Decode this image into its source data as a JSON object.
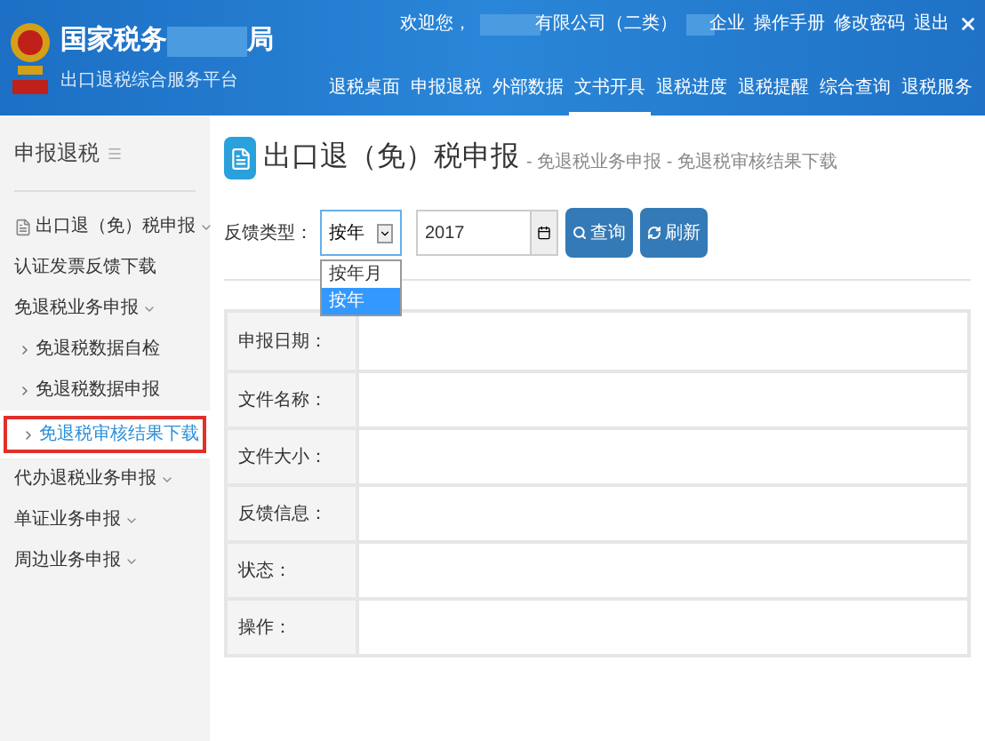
{
  "header": {
    "title": "国家税务",
    "title_suffix": "局",
    "subtitle": "出口退税综合服务平台",
    "greeting": "欢迎您，",
    "company": "有限公司（二类）",
    "user_type": "企业",
    "links": [
      "操作手册",
      "修改密码",
      "退出"
    ],
    "nav": [
      {
        "label": "退税桌面",
        "selected": false
      },
      {
        "label": "申报退税",
        "selected": false
      },
      {
        "label": "外部数据",
        "selected": false
      },
      {
        "label": "文书开具",
        "selected": true
      },
      {
        "label": "退税进度",
        "selected": false
      },
      {
        "label": "退税提醒",
        "selected": false
      },
      {
        "label": "综合查询",
        "selected": false
      },
      {
        "label": "退税服务",
        "selected": false
      }
    ]
  },
  "sidebar": {
    "title": "申报退税",
    "items": [
      {
        "label": "出口退（免）税申报",
        "kind": "menu",
        "selected": false,
        "children": [
          {
            "label": "认证发票反馈下载",
            "kind": "link",
            "selected": false
          },
          {
            "label": "免退税业务申报",
            "kind": "menu",
            "selected": false,
            "children": [
              {
                "label": "免退税数据自检",
                "kind": "sub",
                "selected": false
              },
              {
                "label": "免退税数据申报",
                "kind": "sub",
                "selected": false
              },
              {
                "label": "免退税审核结果下载",
                "kind": "sub",
                "selected": true
              }
            ]
          }
        ]
      },
      {
        "label": "代办退税业务申报",
        "kind": "menu",
        "selected": false
      },
      {
        "label": "单证业务申报",
        "kind": "menu",
        "selected": false
      },
      {
        "label": "周边业务申报",
        "kind": "menu",
        "selected": false
      }
    ]
  },
  "main": {
    "title": "出口退（免）税申报",
    "breadcrumb": " - 免退税业务申报 - 免退税审核结果下载",
    "filter": {
      "label": "反馈类型：",
      "select": {
        "value": "按年",
        "expanded": true,
        "options": [
          {
            "label": "按年月",
            "selected": false
          },
          {
            "label": "按年",
            "selected": true
          }
        ]
      },
      "year": "2017",
      "buttons": [
        {
          "label": "查询",
          "kind": "search"
        },
        {
          "label": "刷新",
          "kind": "refresh"
        }
      ]
    },
    "table": {
      "rows": [
        {
          "label": "申报日期："
        },
        {
          "label": "文件名称："
        },
        {
          "label": "文件大小："
        },
        {
          "label": "反馈信息："
        },
        {
          "label": "状态："
        },
        {
          "label": "操作："
        }
      ]
    }
  }
}
